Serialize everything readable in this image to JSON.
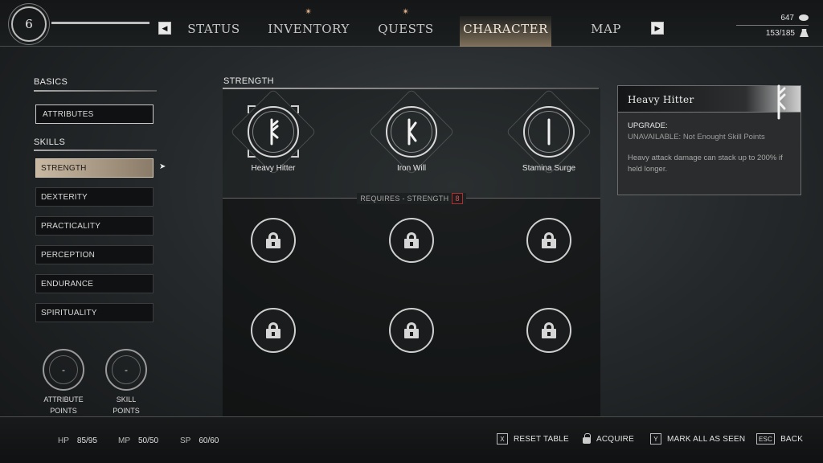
{
  "player": {
    "level": "6",
    "xp_progress": 1.0
  },
  "tabs": [
    {
      "label": "STATUS",
      "starred": false
    },
    {
      "label": "INVENTORY",
      "starred": true
    },
    {
      "label": "QUESTS",
      "starred": true
    },
    {
      "label": "CHARACTER",
      "starred": false,
      "active": true
    },
    {
      "label": "MAP",
      "starred": false
    }
  ],
  "currency": {
    "gold": "647",
    "weight": "153/185"
  },
  "sidebar": {
    "basics_title": "BASICS",
    "attributes_label": "ATTRIBUTES",
    "skills_title": "SKILLS",
    "skills": [
      {
        "label": "STRENGTH",
        "active": true
      },
      {
        "label": "DEXTERITY"
      },
      {
        "label": "PRACTICALITY"
      },
      {
        "label": "PERCEPTION"
      },
      {
        "label": "ENDURANCE"
      },
      {
        "label": "SPIRITUALITY"
      }
    ],
    "attribute_points": {
      "value": "-",
      "label_line1": "ATTRIBUTE",
      "label_line2": "POINTS"
    },
    "skill_points": {
      "value": "-",
      "label_line1": "SKILL",
      "label_line2": "POINTS"
    }
  },
  "skill_tree": {
    "title": "STRENGTH",
    "unlocked": [
      {
        "label": "Heavy Hitter",
        "icon": "rune-heavy-hitter-icon",
        "selected": true
      },
      {
        "label": "Iron Will",
        "icon": "rune-iron-will-icon"
      },
      {
        "label": "Stamina Surge",
        "icon": "rune-stamina-surge-icon"
      }
    ],
    "requires_label": "REQUIRES - STRENGTH",
    "requires_value": "8",
    "locked_count": 6
  },
  "info_card": {
    "title": "Heavy Hitter",
    "upgrade_title": "UPGRADE:",
    "upgrade_status": "UNAVAILABLE: Not Enought Skill Points",
    "description": "Heavy attack damage can stack up to 200% if held longer."
  },
  "stats": {
    "hp_label": "HP",
    "hp_value": "85/95",
    "mp_label": "MP",
    "mp_value": "50/50",
    "sp_label": "SP",
    "sp_value": "60/60"
  },
  "actions": [
    {
      "key": "X",
      "label": "RESET TABLE"
    },
    {
      "key": "",
      "label": "ACQUIRE",
      "icon": "acquire-icon"
    },
    {
      "key": "Y",
      "label": "MARK ALL AS SEEN"
    },
    {
      "key": "ESC",
      "label": "BACK"
    }
  ],
  "colors": {
    "accent": "#c9b9a3",
    "requirement_red": "#e25555"
  }
}
